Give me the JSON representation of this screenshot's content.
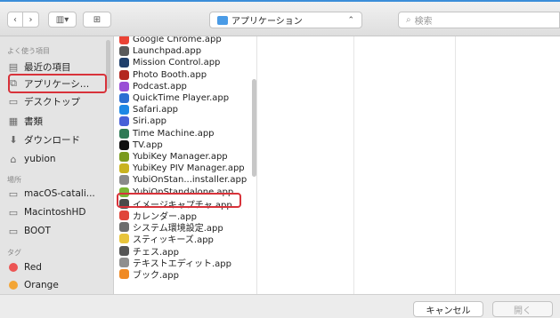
{
  "toolbar": {
    "back_glyph": "‹",
    "forward_glyph": "›",
    "view_glyph": "▥▾",
    "newfolder_glyph": "⊞",
    "location": "アプリケーション",
    "search_placeholder": "検索"
  },
  "sidebar": {
    "favorites_title": "よく使う項目",
    "favorites": [
      {
        "label": "最近の項目",
        "icon": "▤"
      },
      {
        "label": "アプリケーシ…",
        "icon": "⧉"
      },
      {
        "label": "デスクトップ",
        "icon": "▭"
      },
      {
        "label": "書類",
        "icon": "▦"
      },
      {
        "label": "ダウンロード",
        "icon": "⬇"
      },
      {
        "label": "yubion",
        "icon": "⌂"
      }
    ],
    "locations_title": "場所",
    "locations": [
      {
        "label": "macOS-catali...",
        "icon": "▭"
      },
      {
        "label": "MacintoshHD",
        "icon": "▭"
      },
      {
        "label": "BOOT",
        "icon": "▭"
      }
    ],
    "tags_title": "タグ",
    "tags": [
      {
        "label": "Red",
        "color": "#ec5453"
      },
      {
        "label": "Orange",
        "color": "#f3a535"
      }
    ]
  },
  "files": [
    {
      "label": "Google Chrome.app",
      "color": "#ea4335"
    },
    {
      "label": "Launchpad.app",
      "color": "#5a5a5a"
    },
    {
      "label": "Mission Control.app",
      "color": "#1f3f6b"
    },
    {
      "label": "Photo Booth.app",
      "color": "#b32820"
    },
    {
      "label": "Podcast.app",
      "color": "#9a4fd6"
    },
    {
      "label": "QuickTime Player.app",
      "color": "#2c6fd2"
    },
    {
      "label": "Safari.app",
      "color": "#1e88e5"
    },
    {
      "label": "Siri.app",
      "color": "#4760d8"
    },
    {
      "label": "Time Machine.app",
      "color": "#2f7a55"
    },
    {
      "label": "TV.app",
      "color": "#111111"
    },
    {
      "label": "YubiKey Manager.app",
      "color": "#7a9a1e"
    },
    {
      "label": "YubiKey PIV Manager.app",
      "color": "#c9b320"
    },
    {
      "label": "YubiOnStan...installer.app",
      "color": "#8a8a8a"
    },
    {
      "label": "YubiOnStandalone.app",
      "color": "#7ab534"
    },
    {
      "label": "イメージキャプチャ.app",
      "color": "#4a4a4a"
    },
    {
      "label": "カレンダー.app",
      "color": "#e0453a"
    },
    {
      "label": "システム環境設定.app",
      "color": "#6d6d6d"
    },
    {
      "label": "スティッキーズ.app",
      "color": "#e8c43b"
    },
    {
      "label": "チェス.app",
      "color": "#555555"
    },
    {
      "label": "テキストエディット.app",
      "color": "#8f8f8f"
    },
    {
      "label": "ブック.app",
      "color": "#f08a24"
    }
  ],
  "footer": {
    "cancel": "キャンセル",
    "open": "開く"
  },
  "colors": {
    "accent": "#3b8ed9",
    "highlight": "#d8323a"
  }
}
